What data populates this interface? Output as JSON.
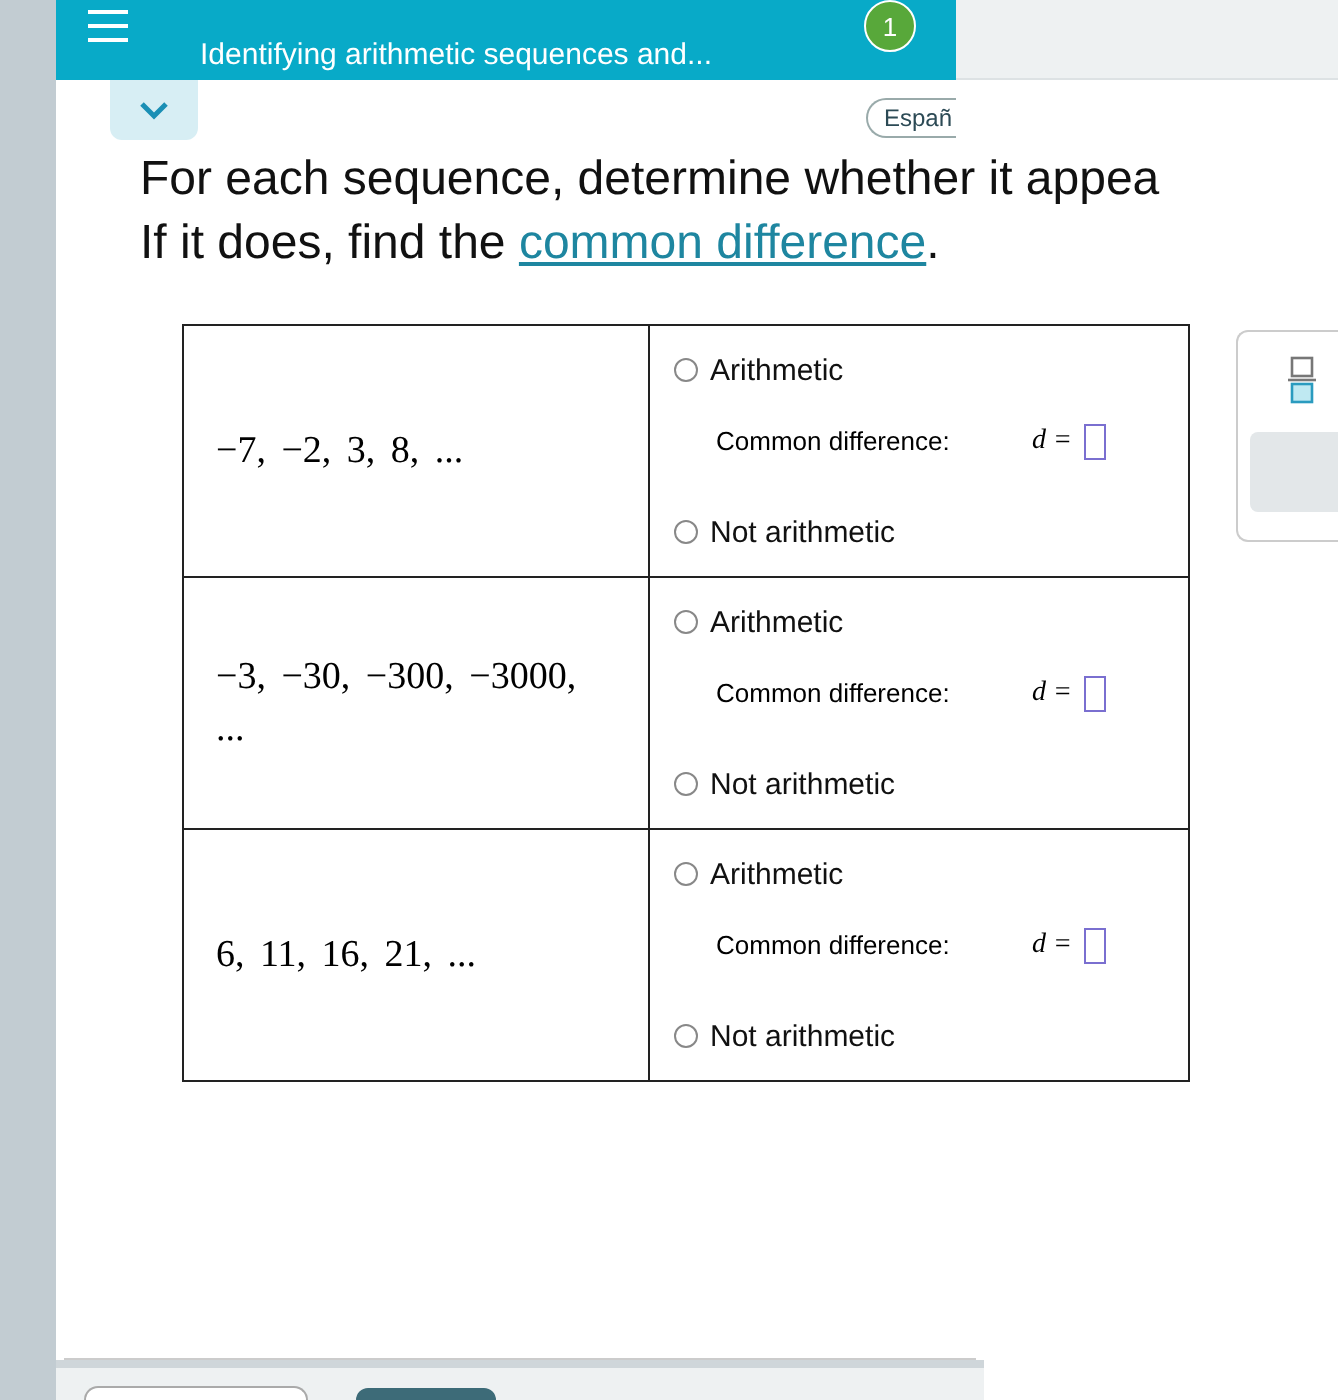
{
  "header": {
    "title": "Identifying arithmetic sequences and...",
    "badge": "1"
  },
  "language_button": "Españ",
  "question": {
    "line_1": "For each sequence, determine whether it appea",
    "line_2_before": "If it does, find the",
    "link": "common difference",
    "line_2_after": "."
  },
  "rows": [
    {
      "sequence": "−7, −2, 3, 8, ...",
      "options": [
        {
          "label": "Arithmetic",
          "selected": false
        },
        {
          "label": "Not arithmetic",
          "selected": false
        }
      ],
      "difference_label": "Common difference:",
      "variable": "d ="
    },
    {
      "sequence": "−3, −30, −300, −3000, ...",
      "options": [
        {
          "label": "Arithmetic",
          "selected": false
        },
        {
          "label": "Not arithmetic",
          "selected": false
        }
      ],
      "difference_label": "Common difference:",
      "variable": "d ="
    },
    {
      "sequence": "6, 11, 16, 21, ...",
      "options": [
        {
          "label": "Arithmetic",
          "selected": false
        },
        {
          "label": "Not arithmetic",
          "selected": false
        }
      ],
      "difference_label": "Common difference:",
      "variable": "d ="
    }
  ]
}
